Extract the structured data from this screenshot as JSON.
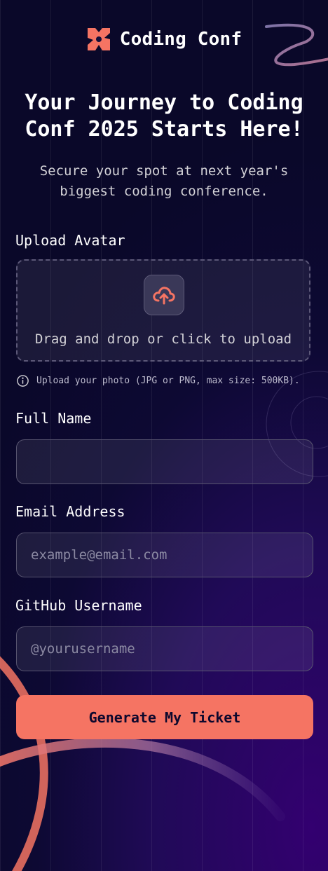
{
  "brand": {
    "name": "Coding Conf",
    "logo_icon": "coding-conf-logo-icon",
    "logo_color": "#f57463"
  },
  "hero": {
    "title": "Your Journey to Coding Conf 2025 Starts Here!",
    "subtitle": "Secure your spot at next year's biggest coding conference."
  },
  "form": {
    "avatar": {
      "label": "Upload Avatar",
      "dropzone_text": "Drag and drop or click to upload",
      "upload_icon": "cloud-upload-icon",
      "hint_icon": "info-icon",
      "hint": "Upload your photo (JPG or PNG, max size: 500KB)."
    },
    "full_name": {
      "label": "Full Name",
      "value": "",
      "placeholder": ""
    },
    "email": {
      "label": "Email Address",
      "value": "",
      "placeholder": "example@email.com"
    },
    "github": {
      "label": "GitHub Username",
      "value": "",
      "placeholder": "@yourusername"
    },
    "submit_label": "Generate My Ticket"
  },
  "colors": {
    "accent": "#f57463",
    "background_dark": "#0a0829",
    "background_purple": "#330070",
    "text_muted": "#d2d1d6"
  }
}
